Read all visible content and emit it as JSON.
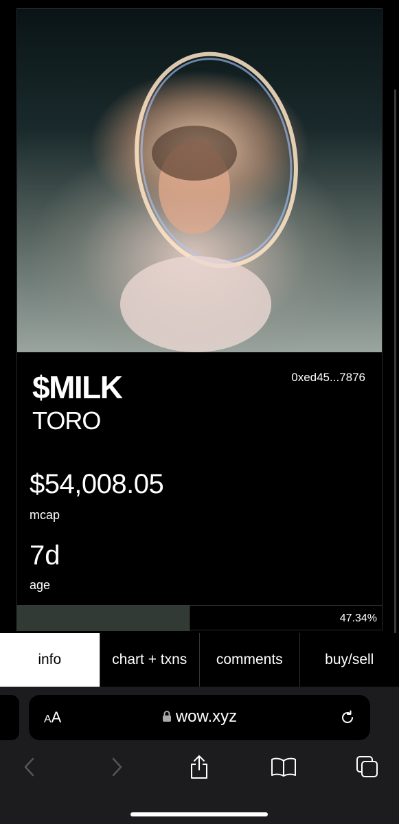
{
  "token": {
    "ticker": "$MILK",
    "name": "TORO",
    "address": "0xed45...7876",
    "mcap_value": "$54,008.05",
    "mcap_label": "mcap",
    "age_value": "7d",
    "age_label": "age"
  },
  "progress": {
    "percent_text": "47.34%",
    "fraction": 0.4734
  },
  "tabs": [
    {
      "label": "info",
      "active": true
    },
    {
      "label": "chart + txns",
      "active": false
    },
    {
      "label": "comments",
      "active": false
    },
    {
      "label": "buy/sell",
      "active": false
    }
  ],
  "browser": {
    "aa_small": "A",
    "aa_large": "A",
    "url": "wow.xyz",
    "icons": [
      "lock-icon",
      "reload-icon",
      "back-icon",
      "forward-icon",
      "share-icon",
      "bookmarks-icon",
      "tabs-icon"
    ]
  },
  "colors": {
    "background": "#000000",
    "progress_fill": "#323a35",
    "active_tab_bg": "#ffffff",
    "toolbar_bg": "#1c1c1e"
  }
}
